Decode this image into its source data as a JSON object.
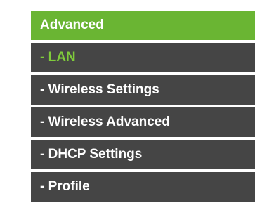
{
  "menu": {
    "header_label": "Advanced",
    "items": [
      {
        "label": "- LAN",
        "active": true
      },
      {
        "label": "- Wireless Settings",
        "active": false
      },
      {
        "label": "- Wireless Advanced",
        "active": false
      },
      {
        "label": "- DHCP Settings",
        "active": false
      },
      {
        "label": "- Profile",
        "active": false
      }
    ]
  },
  "colors": {
    "header_bg": "#6ab533",
    "item_bg": "#454545",
    "active_text": "#7fcb3b",
    "text": "#ffffff"
  }
}
